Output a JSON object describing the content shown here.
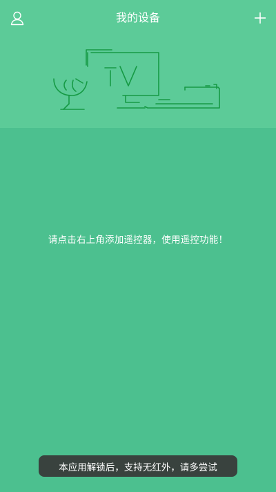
{
  "header": {
    "title": "我的设备",
    "left_icon": "user-icon",
    "right_icon": "plus-icon"
  },
  "illustration": {
    "tv_label": "TV"
  },
  "empty_state": {
    "message": "请点击右上角添加遥控器，使用遥控功能！"
  },
  "toast": {
    "message": "本应用解锁后，支持无红外，请多尝试"
  },
  "colors": {
    "background": "#4cc08f",
    "header_background": "#5ccb98",
    "illustration_stroke": "#169a45",
    "toast_background": "#373737",
    "text": "#ffffff"
  }
}
